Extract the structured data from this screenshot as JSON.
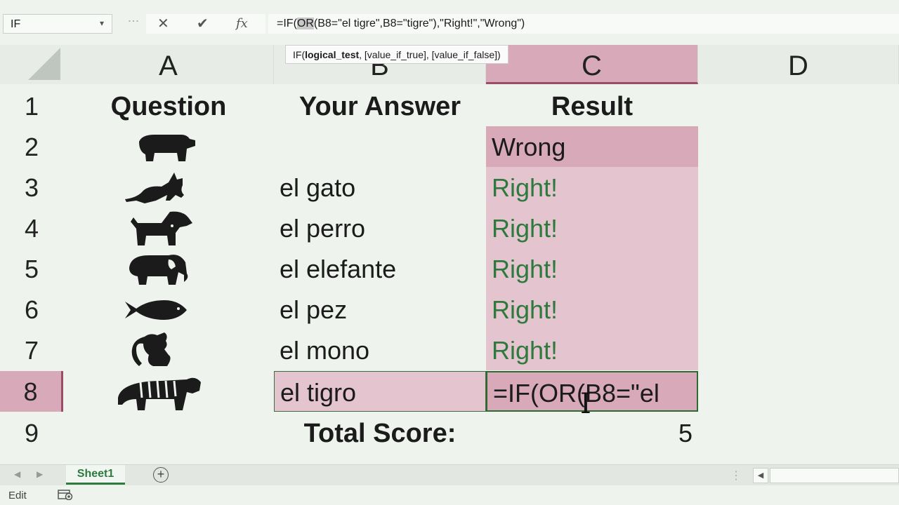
{
  "formula_bar": {
    "name_box": "IF",
    "name_box_dropdown": "▾",
    "cancel_glyph": "✕",
    "enter_glyph": "✔",
    "fx_label": "fx",
    "formula_prefix": "=IF(",
    "formula_highlight": "OR",
    "formula_suffix": "(B8=\"el tigre\",B8=\"tigre\"),\"Right!\",\"Wrong\")"
  },
  "tooltip": {
    "func": "IF(",
    "bold_arg": "logical_test",
    "rest": ", [value_if_true], [value_if_false])"
  },
  "columns": [
    "A",
    "B",
    "C",
    "D"
  ],
  "rows": [
    "1",
    "2",
    "3",
    "4",
    "5",
    "6",
    "7",
    "8",
    "9"
  ],
  "headers": {
    "question": "Question",
    "answer": "Your Answer",
    "result": "Result"
  },
  "table": [
    {
      "icon": "bear-icon",
      "answer": "",
      "result": "Wrong"
    },
    {
      "icon": "cat-icon",
      "answer": "el gato",
      "result": "Right!"
    },
    {
      "icon": "dog-icon",
      "answer": "el perro",
      "result": "Right!"
    },
    {
      "icon": "elephant-icon",
      "answer": "el elefante",
      "result": "Right!"
    },
    {
      "icon": "fish-icon",
      "answer": "el pez",
      "result": "Right!"
    },
    {
      "icon": "monkey-icon",
      "answer": "el mono",
      "result": "Right!"
    },
    {
      "icon": "tiger-icon",
      "answer": "el tigro",
      "result": "=IF(OR(B8=\"el"
    }
  ],
  "total": {
    "label": "Total Score:",
    "value": "5"
  },
  "sheet_tabs": {
    "active": "Sheet1",
    "add_glyph": "+"
  },
  "status": {
    "mode": "Edit"
  },
  "colors": {
    "selected_column": "#d8a9b9",
    "result_fill": "#e4c4cf",
    "right_text": "#2e7a3d",
    "tab_accent": "#2e7a3d"
  }
}
